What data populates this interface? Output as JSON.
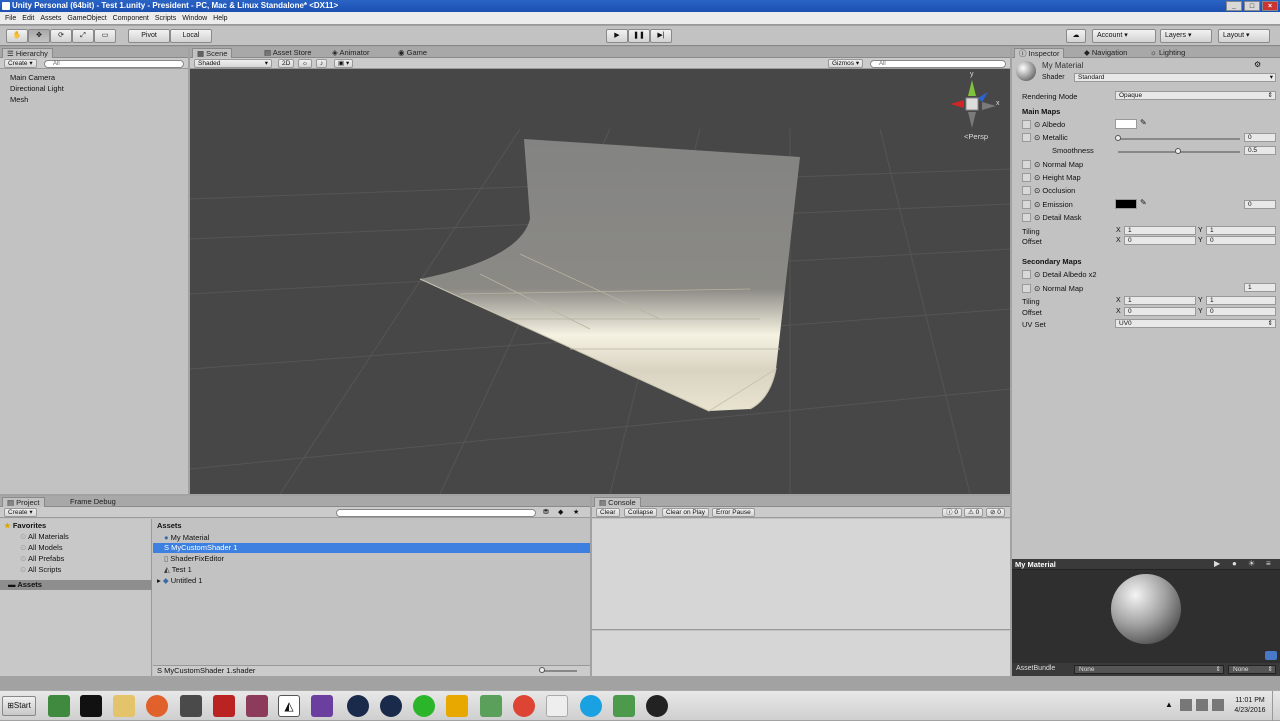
{
  "window": {
    "title": "Unity Personal (64bit) - Test 1.unity - President - PC, Mac & Linux Standalone* <DX11>"
  },
  "menu": [
    "File",
    "Edit",
    "Assets",
    "GameObject",
    "Component",
    "Scripts",
    "Window",
    "Help"
  ],
  "toolbar": {
    "pivot": "Pivot",
    "local": "Local",
    "account": "Account",
    "layers": "Layers",
    "layout": "Layout"
  },
  "hierarchy": {
    "tab": "Hierarchy",
    "create": "Create",
    "search_placeholder": "All",
    "items": [
      "Main Camera",
      "Directional Light",
      "Mesh"
    ]
  },
  "scene": {
    "tabs": [
      "Scene",
      "Asset Store",
      "Animator",
      "Game"
    ],
    "shading": "Shaded",
    "mode2d": "2D",
    "gizmos": "Gizmos",
    "search_placeholder": "All",
    "projection": "Persp",
    "axis_y": "y",
    "axis_x": "x"
  },
  "inspector": {
    "tabs": [
      "Inspector",
      "Navigation",
      "Lighting"
    ],
    "material_name": "My Material",
    "shader_label": "Shader",
    "shader_value": "Standard",
    "rendering_mode_label": "Rendering Mode",
    "rendering_mode_value": "Opaque",
    "main_maps": "Main Maps",
    "albedo": "Albedo",
    "metallic": "Metallic",
    "metallic_value": "0",
    "smoothness": "Smoothness",
    "smoothness_value": "0.5",
    "normal_map": "Normal Map",
    "height_map": "Height Map",
    "occlusion": "Occlusion",
    "emission": "Emission",
    "emission_value": "0",
    "detail_mask": "Detail Mask",
    "tiling": "Tiling",
    "offset": "Offset",
    "x": "X",
    "y": "Y",
    "tiling_x": "1",
    "tiling_y": "1",
    "offset_x": "0",
    "offset_y": "0",
    "secondary_maps": "Secondary Maps",
    "detail_albedo": "Detail Albedo x2",
    "normal_map2": "Normal Map",
    "normal_map2_value": "1",
    "tiling2_x": "1",
    "tiling2_y": "1",
    "offset2_x": "0",
    "offset2_y": "0",
    "uv_set": "UV Set",
    "uv_set_value": "UV0"
  },
  "preview": {
    "title": "My Material",
    "assetbundle_label": "AssetBundle",
    "assetbundle_value": "None",
    "variant_value": "None"
  },
  "project": {
    "tabs": [
      "Project",
      "Frame Debug"
    ],
    "create": "Create",
    "favorites": "Favorites",
    "favorite_items": [
      "All Materials",
      "All Models",
      "All Prefabs",
      "All Scripts"
    ],
    "assets_root": "Assets",
    "assets_header": "Assets",
    "files": [
      "My Material",
      "MyCustomShader 1",
      "ShaderFixEditor",
      "Test 1",
      "Untitled 1"
    ],
    "selected_path": "MyCustomShader 1.shader"
  },
  "console": {
    "tab": "Console",
    "buttons": [
      "Clear",
      "Collapse",
      "Clear on Play",
      "Error Pause"
    ],
    "counts": [
      "0",
      "0",
      "0"
    ]
  },
  "taskbar": {
    "start": "Start",
    "time": "11:01 PM",
    "date": "4/23/2016"
  },
  "colors": {
    "selection": "#3d80df",
    "viewport_bg": "#474747",
    "titlebar": "#2a64c5"
  }
}
